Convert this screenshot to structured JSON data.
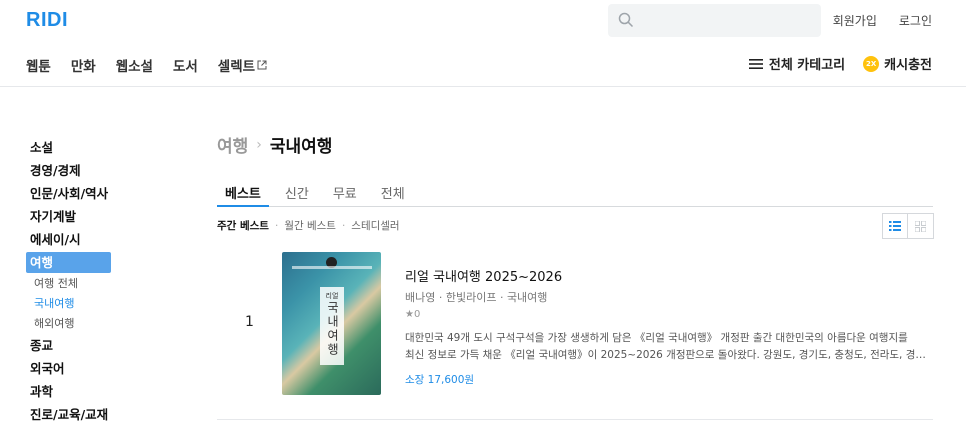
{
  "header": {
    "logo": "RIDI",
    "search_placeholder": "",
    "signup": "회원가입",
    "login": "로그인"
  },
  "nav": {
    "items": [
      "웹툰",
      "만화",
      "웹소설",
      "도서",
      "셀렉트"
    ],
    "all_categories": "전체 카테고리",
    "coin_badge": "2X",
    "cash": "캐시충전"
  },
  "sidebar": {
    "items": [
      "소설",
      "경영/경제",
      "인문/사회/역사",
      "자기계발",
      "에세이/시",
      "여행"
    ],
    "subitems": [
      "여행 전체",
      "국내여행",
      "해외여행"
    ],
    "after_items": [
      "종교",
      "외국어",
      "과학",
      "진로/교육/교재"
    ]
  },
  "breadcrumb": {
    "parent": "여행",
    "separator": "›",
    "current": "국내여행"
  },
  "tabs": [
    "베스트",
    "신간",
    "무료",
    "전체"
  ],
  "sort": {
    "options": [
      "주간 베스트",
      "월간 베스트",
      "스테디셀러"
    ]
  },
  "book": {
    "rank": "1",
    "cover_text": "국내여행",
    "cover_prefix": "리얼",
    "title": "리얼 국내여행 2025~2026",
    "meta": "배나영 · 한빛라이프 · 국내여행",
    "rating": "★0",
    "desc_line1": "대한민국 49개 도시 구석구석을 가장 생생하게 담은 《리얼 국내여행》 개정판 출간 대한민국의 아름다운 여행지를",
    "desc_line2": "최신 정보로 가득 채운 《리얼 국내여행》이 2025~2026 개정판으로 돌아왔다. 강원도, 경기도, 충청도, 전라도, 경상...",
    "price": "소장 17,600원"
  },
  "colors": {
    "accent": "#1f8ce6",
    "sidebar_active": "#59a3ea",
    "coin": "#ffc20d"
  }
}
